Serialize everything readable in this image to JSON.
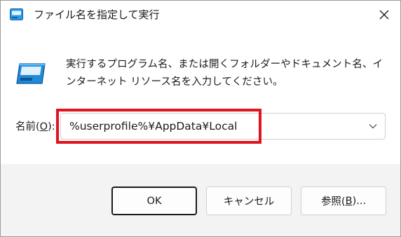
{
  "window": {
    "title": "ファイル名を指定して実行",
    "close_glyph": "✕"
  },
  "description": "実行するプログラム名、または開くフォルダーやドキュメント名、インターネット リソース名を入力してください。",
  "name_field": {
    "label_prefix": "名前(",
    "label_accel": "O",
    "label_suffix": "):",
    "value": "%userprofile%¥AppData¥Local"
  },
  "buttons": {
    "ok": "OK",
    "cancel": "キャンセル",
    "browse_prefix": "参照(",
    "browse_accel": "B",
    "browse_suffix": ")..."
  },
  "colors": {
    "highlight": "#e0141e",
    "dialog_bg": "#f3f3f3",
    "content_bg": "#ffffff",
    "icon_blue": "#1f8ad6"
  },
  "icons": {
    "title": "run-app-icon",
    "main": "run-app-icon",
    "close": "close-icon",
    "dropdown": "chevron-down-icon"
  }
}
